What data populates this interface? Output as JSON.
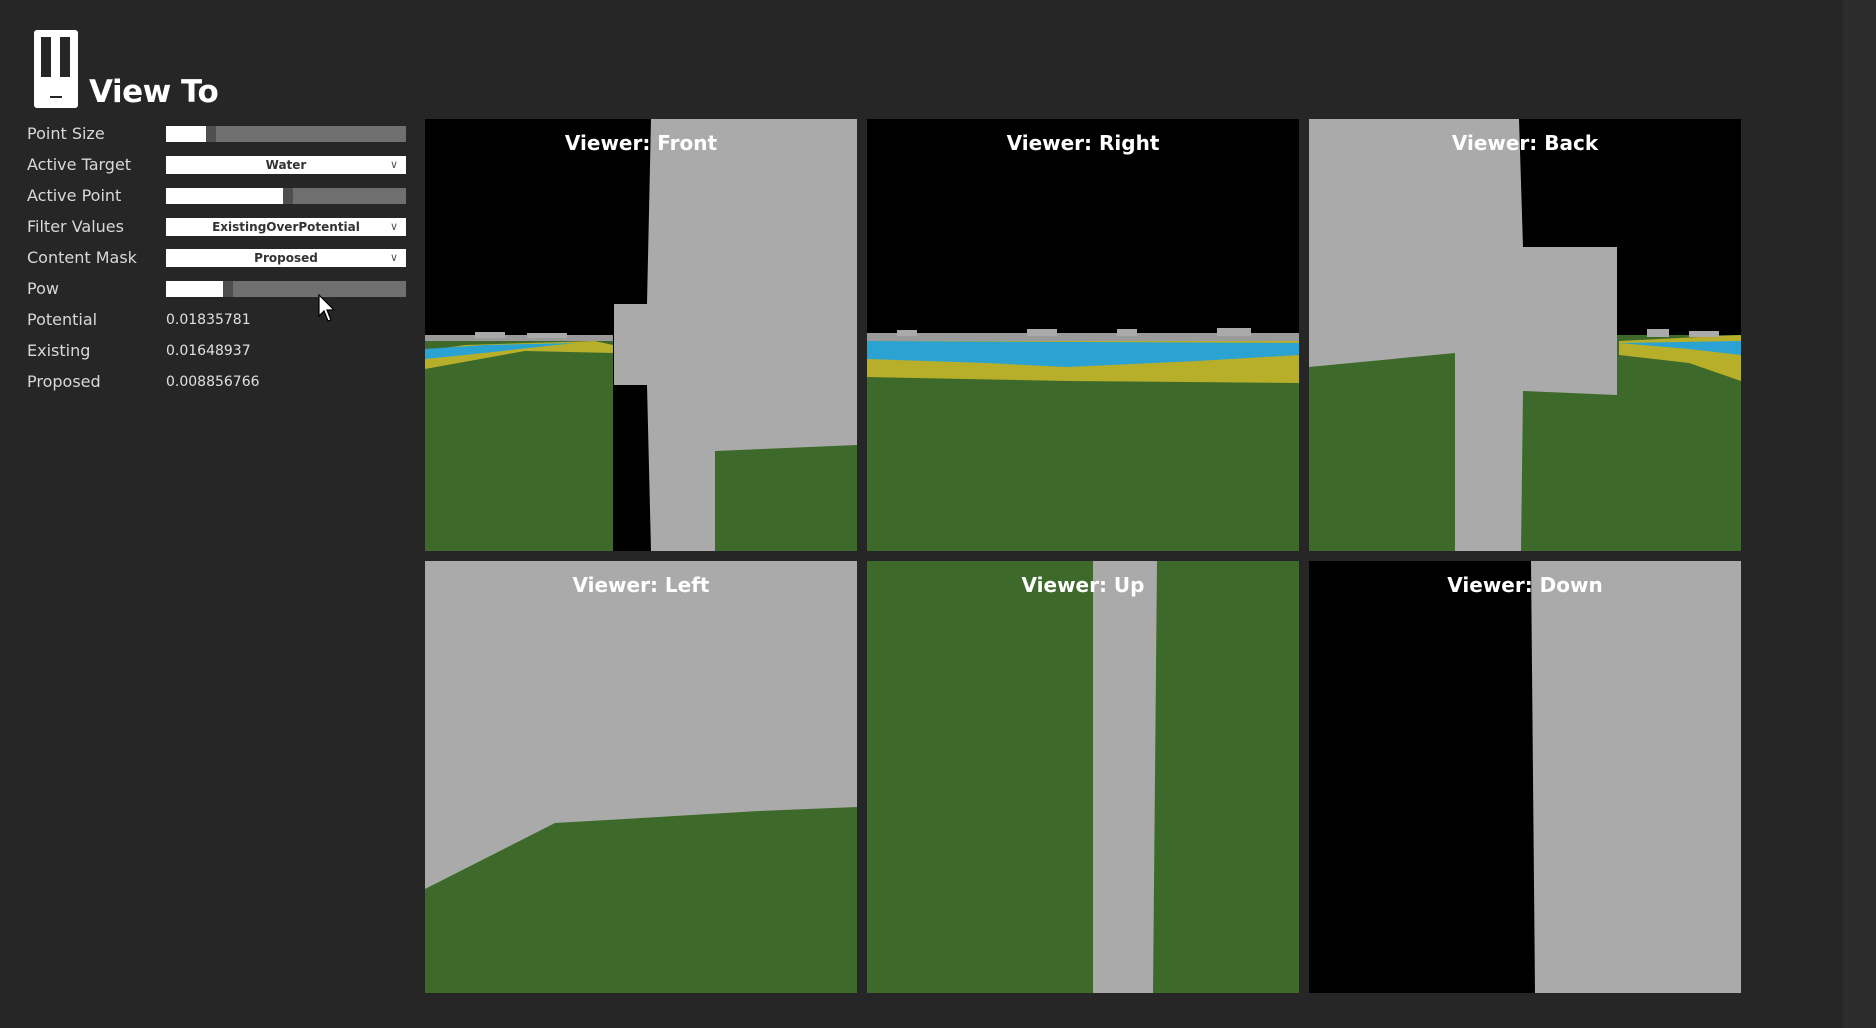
{
  "app": {
    "title": "View To"
  },
  "controls": {
    "point_size": {
      "label": "Point Size",
      "value": 0.17
    },
    "active_target": {
      "label": "Active Target",
      "selected": "Water"
    },
    "active_point": {
      "label": "Active Point",
      "value": 0.49
    },
    "filter_values": {
      "label": "Filter Values",
      "selected": "ExistingOverPotential"
    },
    "content_mask": {
      "label": "Content Mask",
      "selected": "Proposed"
    },
    "pow": {
      "label": "Pow",
      "value": 0.24
    },
    "potential": {
      "label": "Potential",
      "value": "0.01835781"
    },
    "existing": {
      "label": "Existing",
      "value": "0.01648937"
    },
    "proposed": {
      "label": "Proposed",
      "value": "0.008856766"
    }
  },
  "viewers": {
    "front": "Viewer: Front",
    "right": "Viewer: Right",
    "back": "Viewer: Back",
    "left": "Viewer: Left",
    "up": "Viewer: Up",
    "down": "Viewer: Down"
  },
  "colors": {
    "sky": "#000000",
    "ground": "#3d6a2a",
    "building": "#aaaaaa",
    "water": "#2aa3d3",
    "sand": "#b7ae2a",
    "panel_bg": "#262626"
  }
}
